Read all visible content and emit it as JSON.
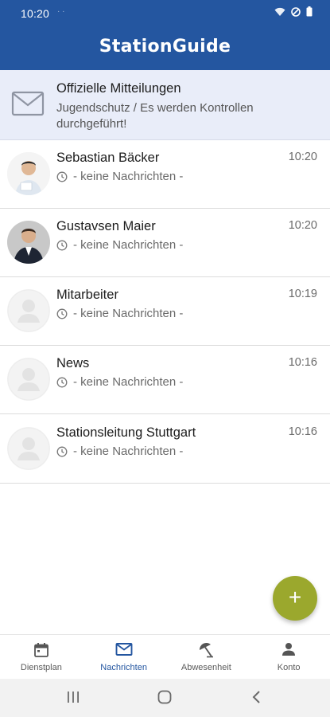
{
  "status": {
    "time": "10:20",
    "dots": "· ·"
  },
  "app": {
    "title": "StationGuide"
  },
  "announcement": {
    "title": "Offizielle Mitteilungen",
    "text": "Jugendschutz / Es werden Kontrollen durchgeführt!"
  },
  "chats": [
    {
      "name": "Sebastian Bäcker",
      "preview": "- keine Nachrichten -",
      "time": "10:20",
      "avatar": "photo-man-white-shirt"
    },
    {
      "name": "Gustavsen Maier",
      "preview": "- keine Nachrichten -",
      "time": "10:20",
      "avatar": "photo-man-dark-suit"
    },
    {
      "name": "Mitarbeiter",
      "preview": "- keine Nachrichten -",
      "time": "10:19",
      "avatar": "default-person-icon"
    },
    {
      "name": "News",
      "preview": "- keine Nachrichten -",
      "time": "10:16",
      "avatar": "default-person-icon"
    },
    {
      "name": "Stationsleitung Stuttgart",
      "preview": "- keine Nachrichten -",
      "time": "10:16",
      "avatar": "default-person-icon"
    }
  ],
  "fab": {
    "label": "+"
  },
  "nav": [
    {
      "label": "Dienstplan",
      "icon": "calendar-icon",
      "active": false
    },
    {
      "label": "Nachrichten",
      "icon": "mail-icon",
      "active": true
    },
    {
      "label": "Abwesenheit",
      "icon": "beach-umbrella-icon",
      "active": false
    },
    {
      "label": "Konto",
      "icon": "person-icon",
      "active": false
    }
  ],
  "colors": {
    "primary": "#2456a0",
    "announcement_bg": "#e9edf9",
    "fab": "#9ba82d"
  }
}
